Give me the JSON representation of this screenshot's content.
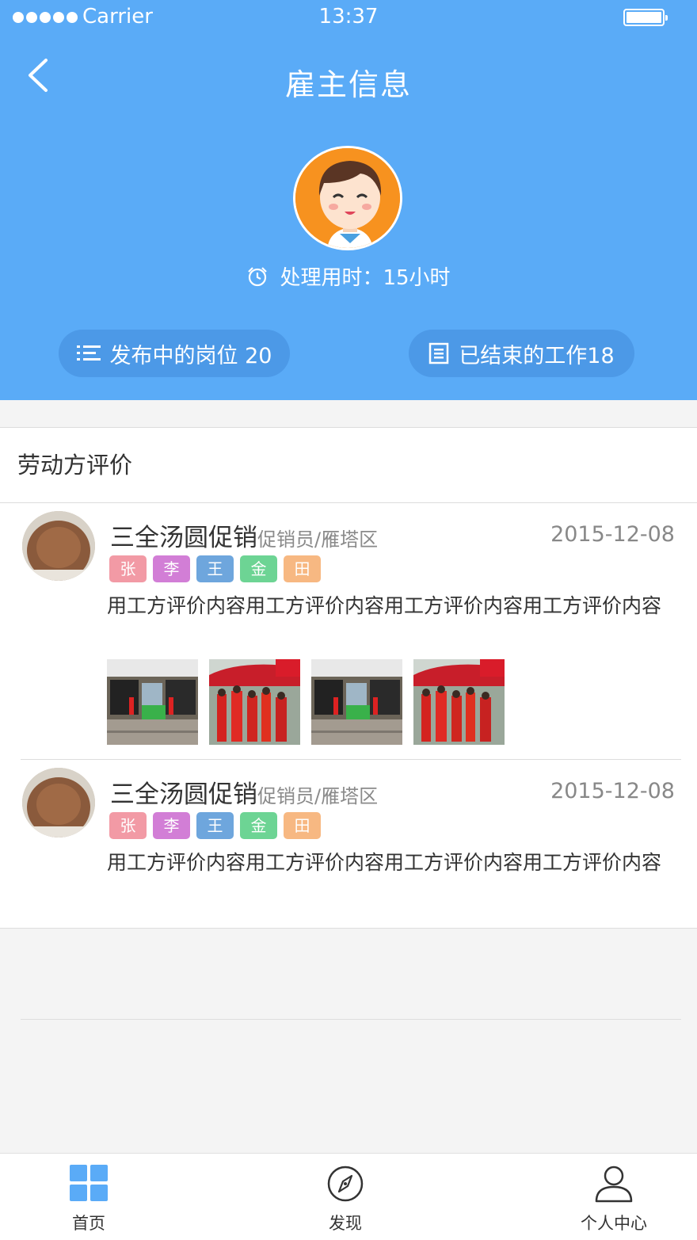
{
  "status_bar": {
    "carrier": "Carrier",
    "time": "13:37"
  },
  "header": {
    "title": "雇主信息",
    "processing_time": "处理用时：15小时",
    "stats": [
      {
        "label": "发布中的岗位 20",
        "icon": "list-icon"
      },
      {
        "label": "已结束的工作18",
        "icon": "document-icon"
      }
    ]
  },
  "reviews_section": {
    "title": "劳动方评价",
    "items": [
      {
        "name": "三全汤圆促销",
        "role": "促销员/雁塔区",
        "date": "2015-12-08",
        "tags": [
          "张",
          "李",
          "王",
          "金",
          "田"
        ],
        "content": "用工方评价内容用工方评价内容用工方评价内容用工方评价内容",
        "photo_count": 4
      },
      {
        "name": "三全汤圆促销",
        "role": "促销员/雁塔区",
        "date": "2015-12-08",
        "tags": [
          "张",
          "李",
          "王",
          "金",
          "田"
        ],
        "content": "用工方评价内容用工方评价内容用工方评价内容用工方评价内容",
        "photo_count": 0
      }
    ],
    "tag_colors": [
      "#f29aa5",
      "#d27ed6",
      "#6ea6dd",
      "#6dd494",
      "#f7b882"
    ]
  },
  "tab_bar": {
    "items": [
      {
        "label": "首页",
        "icon": "grid-icon",
        "active": true
      },
      {
        "label": "发现",
        "icon": "compass-icon",
        "active": false
      },
      {
        "label": "个人中心",
        "icon": "person-icon",
        "active": false
      }
    ]
  },
  "colors": {
    "header_bg": "#5aabf7",
    "accent": "#5aabf7"
  }
}
